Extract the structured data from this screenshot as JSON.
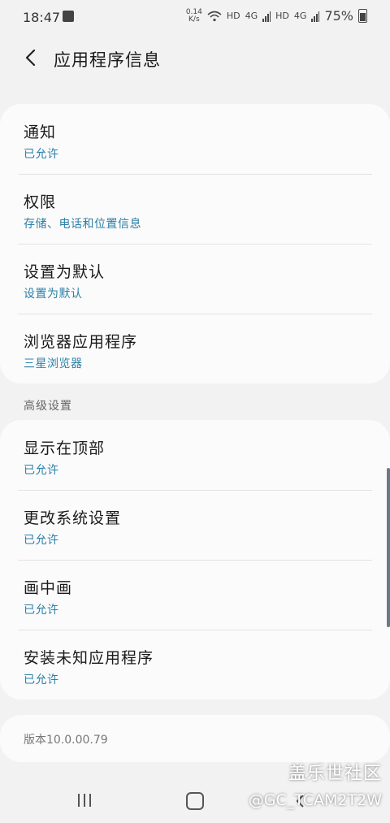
{
  "status_bar": {
    "time": "18:47",
    "net_speed_top": "0.14",
    "net_speed_unit": "K/s",
    "hd1": "HD",
    "sig1": "4G",
    "hd2": "HD",
    "sig2": "4G",
    "battery": "75%"
  },
  "header": {
    "title": "应用程序信息"
  },
  "card1": {
    "rows": [
      {
        "title": "通知",
        "sub": "已允许"
      },
      {
        "title": "权限",
        "sub": "存储、电话和位置信息"
      },
      {
        "title": "设置为默认",
        "sub": "设置为默认"
      },
      {
        "title": "浏览器应用程序",
        "sub": "三星浏览器"
      }
    ]
  },
  "advanced": {
    "section_title": "高级设置",
    "rows": [
      {
        "title": "显示在顶部",
        "sub": "已允许"
      },
      {
        "title": "更改系统设置",
        "sub": "已允许"
      },
      {
        "title": "画中画",
        "sub": "已允许"
      },
      {
        "title": "安装未知应用程序",
        "sub": "已允许"
      }
    ]
  },
  "version": "版本10.0.00.79",
  "watermark": {
    "line1": "盖乐世社区",
    "line2": "@GC_TCAM2T2W"
  },
  "colors": {
    "background": "#f2f2f2",
    "card": "#fbfbfb",
    "accent_sub": "#2a7fa8"
  }
}
